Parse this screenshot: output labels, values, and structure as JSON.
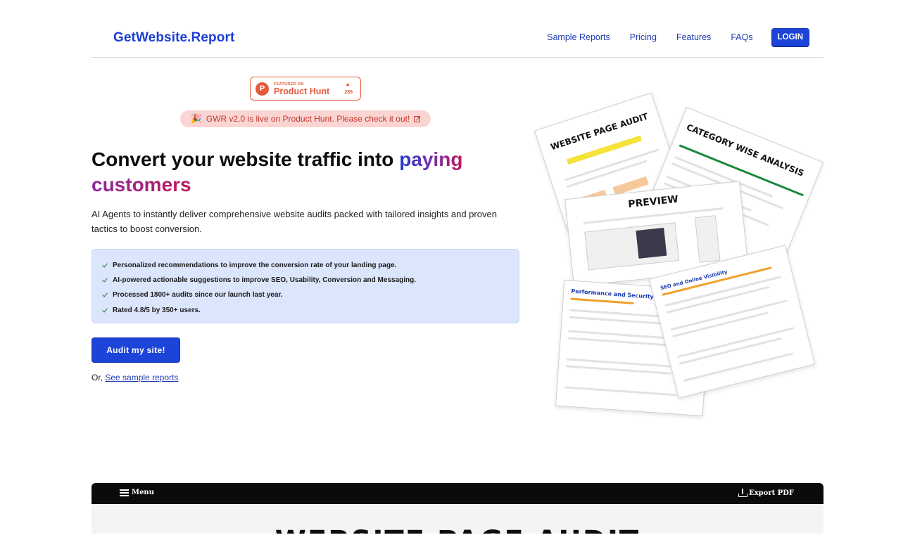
{
  "header": {
    "brand": "GetWebsite.Report",
    "nav": [
      "Sample Reports",
      "Pricing",
      "Features",
      "FAQs"
    ],
    "login": "LOGIN"
  },
  "product_hunt": {
    "featured": "FEATURED ON",
    "name": "Product Hunt",
    "count": "289",
    "logo_letter": "P"
  },
  "announcement": "GWR v2.0 is live on Product Hunt. Please check it out!",
  "hero": {
    "headline_start": "Convert your website traffic into",
    "headline_word1": "paying",
    "headline_word2": "customers",
    "subtext": "AI Agents to instantly deliver comprehensive website audits packed with tailored insights and proven tactics to boost conversion.",
    "features": [
      "Personalized recommendations to improve the conversion rate of your landing page.",
      "AI-powered actionable suggestions to improve SEO, Usability, Conversion and Messaging.",
      "Processed 1800+ audits since our launch last year.",
      "Rated 4.8/5 by 350+ users."
    ],
    "cta": "Audit my site!",
    "or": "Or,",
    "sample_link": "See sample reports"
  },
  "art": {
    "card1": "WEBSITE PAGE AUDIT",
    "card2": "CATEGORY WISE ANALYSIS",
    "card3": "PREVIEW",
    "card4": "Performance and Security",
    "card5": "SEO and Online Visibility"
  },
  "demo": {
    "menu": "Menu",
    "export": "Export PDF",
    "title": "WEBSITE PAGE AUDIT"
  },
  "colors": {
    "brand": "#1b3fd6",
    "accent_pink": "#c2185b",
    "product_hunt": "#e45b3b",
    "feature_bg": "#dbe5fb"
  }
}
